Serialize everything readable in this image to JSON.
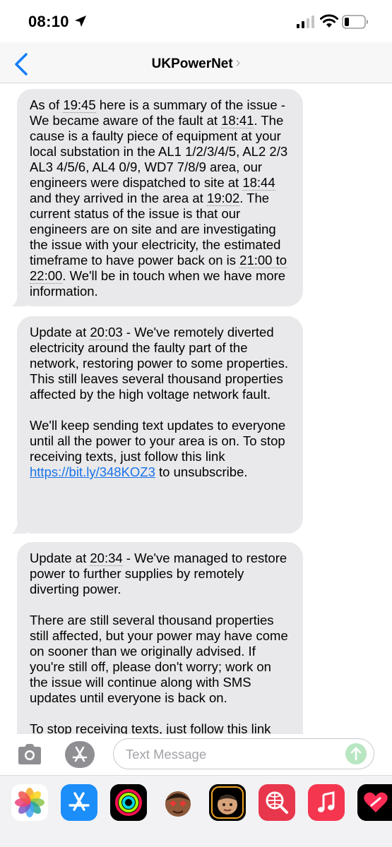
{
  "status_bar": {
    "time": "08:10",
    "icons": [
      "location-arrow-icon",
      "cellular-signal-icon",
      "wifi-icon",
      "battery-icon"
    ]
  },
  "header": {
    "contact_name": "UKPowerNet",
    "chevron": "›",
    "back_icon": "chevron-left-icon"
  },
  "messages": [
    {
      "parts": [
        {
          "t": "As of "
        },
        {
          "t": "19:45",
          "u": true
        },
        {
          "t": " here is a summary of the issue - We became aware of the fault at "
        },
        {
          "t": "18:41",
          "u": true
        },
        {
          "t": ". The cause is a faulty piece of equipment at your local substation in the AL1 1/2/3/4/5, AL2 2/3 AL3 4/5/6, AL4 0/9, WD7 7/8/9 area, our engineers were dispatched to site at "
        },
        {
          "t": "18:44",
          "u": true
        },
        {
          "t": " and they arrived in the area at "
        },
        {
          "t": "19:02",
          "u": true
        },
        {
          "t": ". The current status of the issue is that our engineers are on site and are investigating the issue with your electricity, the estimated timeframe to have power back on is "
        },
        {
          "t": "21:00 to 22:00",
          "u": true
        },
        {
          "t": ". We'll be in touch when we have more information."
        }
      ]
    },
    {
      "parts": [
        {
          "t": "Update at "
        },
        {
          "t": "20:03",
          "u": true
        },
        {
          "t": " - We've remotely diverted electricity around the faulty part of the network, restoring power to some properties. This still leaves several thousand properties affected by the high voltage network fault."
        },
        {
          "br": true
        },
        {
          "t": "We'll keep sending text updates to everyone until all the power to your area is on. To stop receiving texts, just follow this link "
        },
        {
          "t": "https://bit.ly/348KOZ3",
          "link": true
        },
        {
          "t": " to unsubscribe."
        }
      ]
    },
    {
      "parts": [
        {
          "t": "Update at "
        },
        {
          "t": "20:34",
          "u": true
        },
        {
          "t": " - We've managed to restore power to further supplies by remotely diverting power."
        },
        {
          "br": true
        },
        {
          "t": "There are still several thousand properties still affected, but your power may have come on sooner than we originally advised. If you're still off, please don't worry; work on the issue will continue along with SMS updates until everyone is back on."
        },
        {
          "br": true
        },
        {
          "t": "To stop receiving texts, just follow this link"
        }
      ]
    }
  ],
  "composer": {
    "placeholder": "Text Message",
    "icons": [
      "camera-icon",
      "app-store-icon",
      "send-arrow-icon"
    ]
  },
  "app_drawer": [
    {
      "name": "photos-app-icon"
    },
    {
      "name": "app-store-app-icon"
    },
    {
      "name": "activity-app-icon"
    },
    {
      "name": "memoji-heart-eyes-app-icon"
    },
    {
      "name": "memoji-stickers-app-icon"
    },
    {
      "name": "web-search-app-icon"
    },
    {
      "name": "music-app-icon"
    },
    {
      "name": "digital-touch-app-icon"
    }
  ],
  "colors": {
    "bubble": "#e9e9eb",
    "link": "#1a73e8",
    "ios_blue": "#147efb",
    "send_disabled": "#b8e6c1"
  }
}
